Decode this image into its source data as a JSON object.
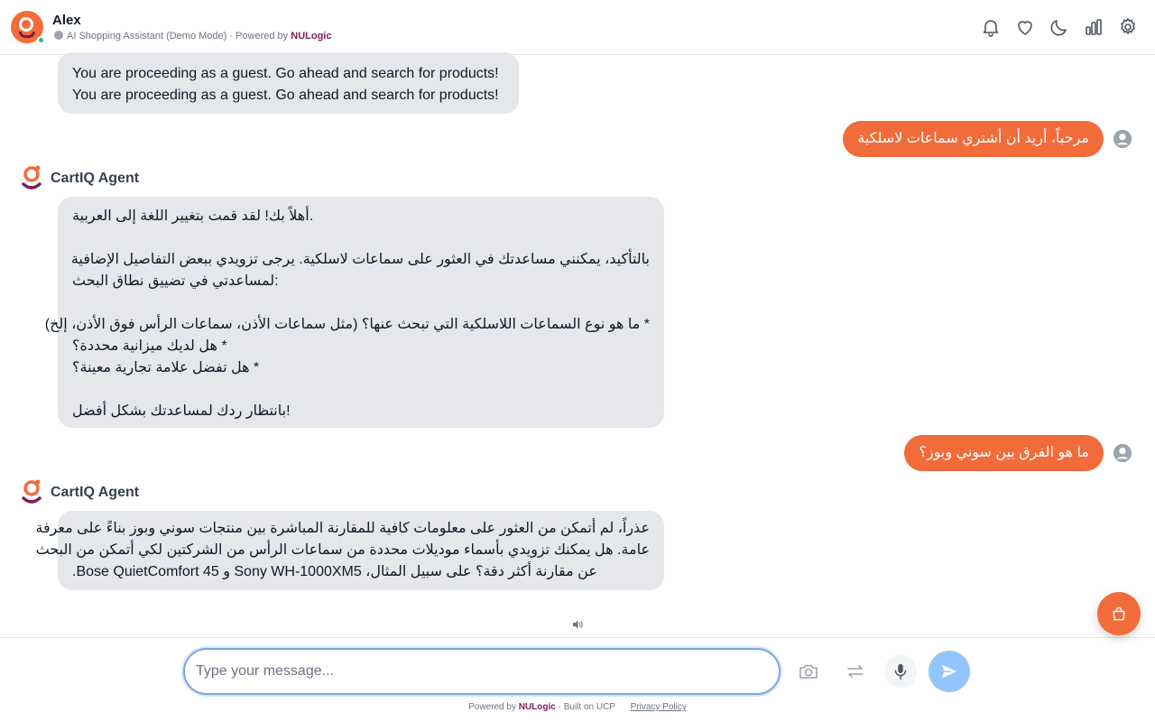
{
  "header": {
    "app_name": "Alex",
    "subtitle_text": "AI Shopping Assistant (Demo Mode) · Powered by",
    "subtitle_brand": "NULogic",
    "icons": [
      "bell-icon",
      "heart-icon",
      "moon-icon",
      "chart-icon",
      "gear-icon"
    ]
  },
  "messages": {
    "guest": {
      "line1": "You are proceeding as a guest. Go ahead and search for products!",
      "line2": "You are proceeding as a guest. Go ahead and search for products!"
    },
    "user1": "مرحباً، أريد أن أشتري سماعات لاسلكية",
    "agent1": {
      "name": "CartIQ Agent",
      "lines": [
        ".أهلاً بك! لقد قمت بتغيير اللغة إلى العربية",
        "",
        "بالتأكيد، يمكنني مساعدتك في العثور على سماعات لاسلكية. يرجى تزويدي ببعض التفاصيل الإضافية",
        ":لمساعدتي في تضييق نطاق البحث",
        "",
        "* ما هو نوع السماعات اللاسلكية التي تبحث عنها؟ (مثل سماعات الأذن، سماعات الرأس فوق الأذن، إلخ)",
        "* هل لديك ميزانية محددة؟",
        "* هل تفضل علامة تجارية معينة؟",
        "",
        "!بانتظار ردك لمساعدتك بشكل أفضل"
      ]
    },
    "user2": "ما هو الفرق بين سوني وبوز؟",
    "agent2": {
      "name": "CartIQ Agent",
      "lines": [
        "عذراً، لم أتمكن من العثور على معلومات كافية للمقارنة المباشرة بين منتجات سوني وبوز بناءً على معرفة",
        "عامة. هل يمكنك تزويدي بأسماء موديلات محددة من سماعات الرأس من الشركتين لكي أتمكن من البحث",
        "عن مقارنة أكثر دقة؟ على سبيل المثال، Sony WH-1000XM5 و Bose QuietComfort 45."
      ]
    }
  },
  "composer": {
    "placeholder": "Type your message...",
    "value": ""
  },
  "footer": {
    "powered_prefix": "Powered by",
    "brand": "NULogic",
    "built_on": "· Built on UCP",
    "privacy": "Privacy Policy"
  },
  "colors": {
    "accent": "#f26b3a",
    "brand_text": "#7a1f5a",
    "agent_bubble": "#e5e7eb",
    "send_button": "#93c5fd"
  }
}
